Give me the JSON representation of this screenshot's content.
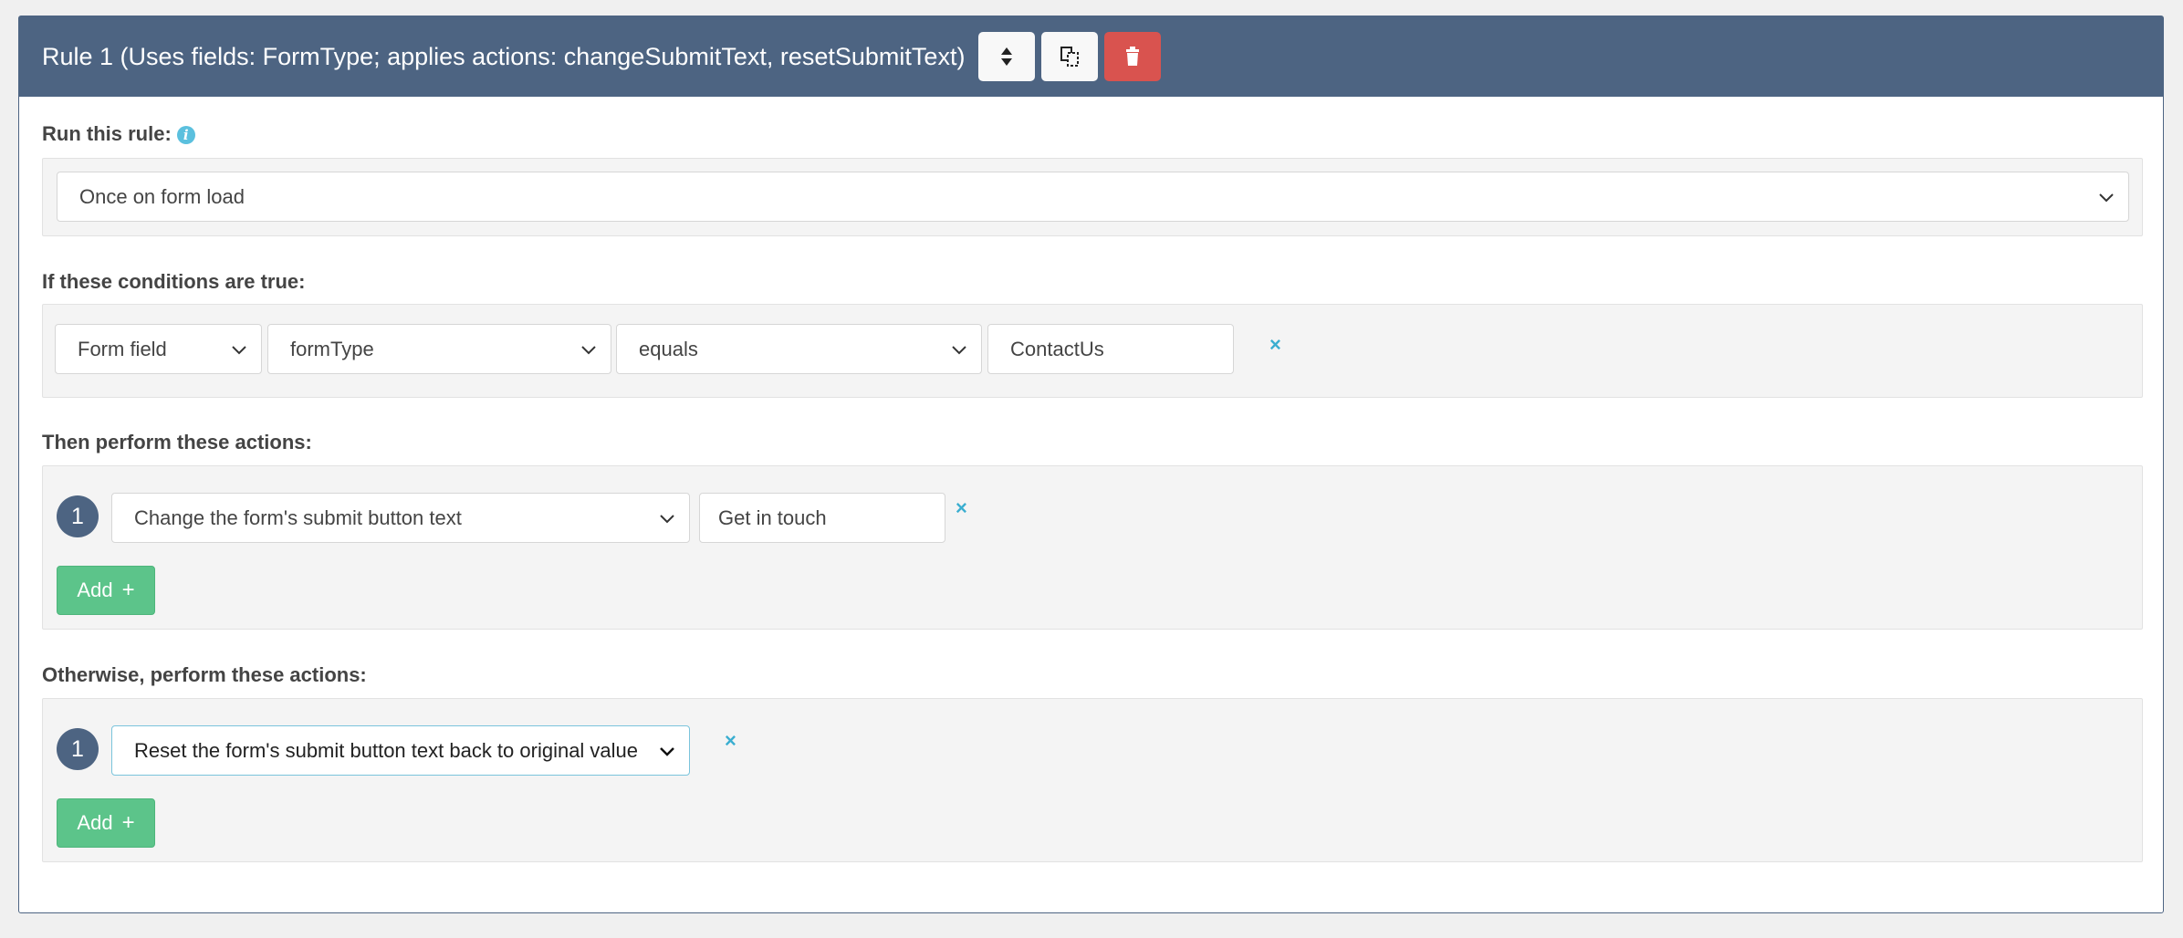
{
  "header": {
    "title": "Rule 1 (Uses fields: FormType; applies actions: changeSubmitText, resetSubmitText)",
    "reorder_icon": "sort-icon",
    "copy_icon": "copy-icon",
    "delete_icon": "trash-icon"
  },
  "run_rule": {
    "label": "Run this rule:",
    "value": "Once on form load"
  },
  "conditions": {
    "label": "If these conditions are true:",
    "source": "Form field",
    "field": "formType",
    "operator": "equals",
    "value": "ContactUs",
    "remove": "×"
  },
  "then_actions": {
    "label": "Then perform these actions:",
    "items": [
      {
        "number": "1",
        "action": "Change the form's submit button text",
        "value": "Get in touch",
        "remove": "×"
      }
    ],
    "add_label": "Add",
    "add_plus": "+"
  },
  "else_actions": {
    "label": "Otherwise, perform these actions:",
    "items": [
      {
        "number": "1",
        "action": "Reset the form's submit button text back to original value",
        "remove": "×"
      }
    ],
    "add_label": "Add",
    "add_plus": "+"
  },
  "colors": {
    "header_bg": "#4d6482",
    "danger": "#d9534f",
    "success": "#5cc48a",
    "accent": "#3aaed0"
  }
}
